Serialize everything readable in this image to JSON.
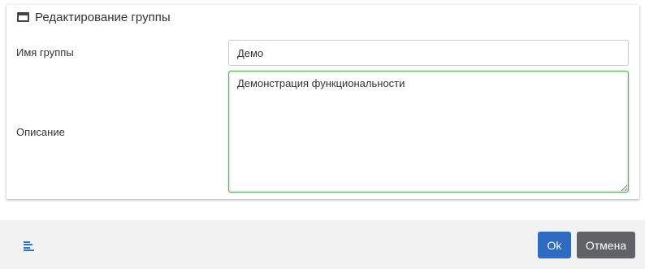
{
  "panel": {
    "title": "Редактирование группы",
    "icon": "window-icon"
  },
  "form": {
    "name_label": "Имя группы",
    "name_value": "Демо",
    "description_label": "Описание",
    "description_value": "Демонстрация функциональности"
  },
  "footer": {
    "menu_icon": "menu-lines-icon",
    "ok_label": "Ok",
    "cancel_label": "Отмена"
  },
  "colors": {
    "ok_button": "#2f6bc0",
    "cancel_button": "#5f6368",
    "focus_border": "#5cb85c",
    "menu_icon": "#2f6fd6"
  }
}
